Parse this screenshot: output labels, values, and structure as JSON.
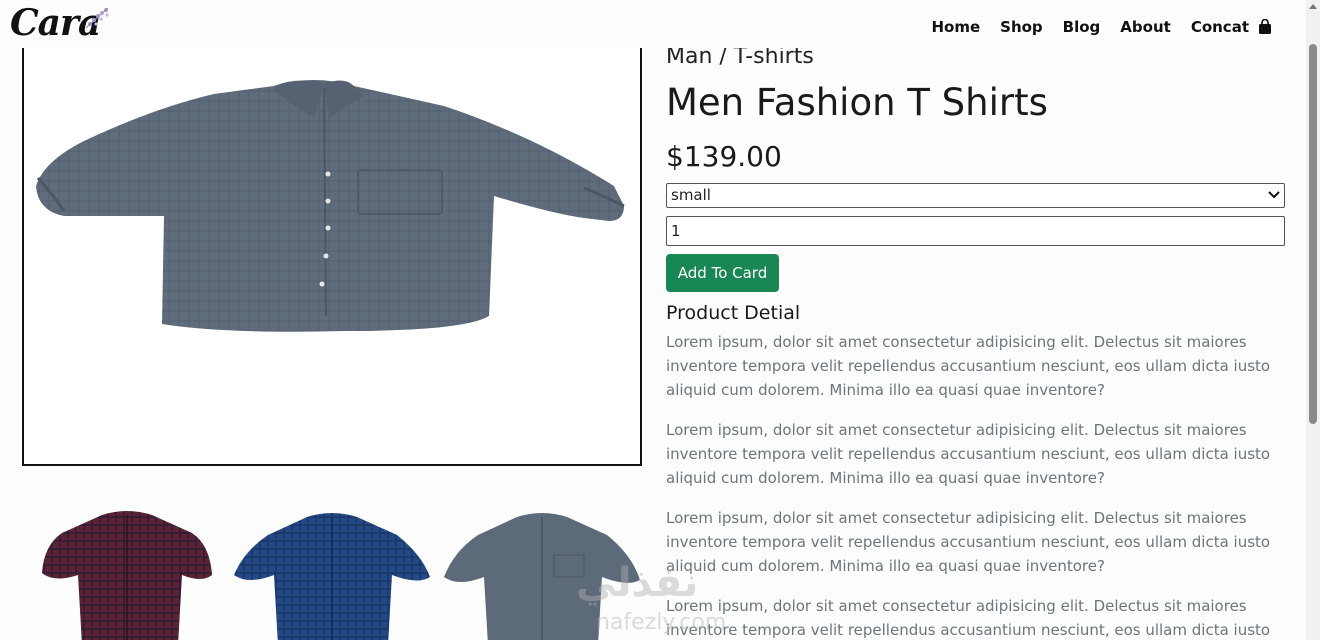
{
  "brand": {
    "logo_text": "Cara"
  },
  "nav": {
    "items": [
      {
        "label": "Home"
      },
      {
        "label": "Shop"
      },
      {
        "label": "Blog"
      },
      {
        "label": "About"
      },
      {
        "label": "Concat"
      }
    ],
    "cart_icon": "shopping-bag-icon"
  },
  "product": {
    "breadcrumb": "Man / T-shirts",
    "title": "Men Fashion T Shirts",
    "price": "$139.00",
    "size_selected": "small",
    "quantity_value": "1",
    "add_button_label": "Add To Card",
    "details_heading": "Product Detial",
    "paragraphs": [
      "Lorem ipsum, dolor sit amet consectetur adipisicing elit. Delectus sit maiores inventore tempora velit repellendus accusantium nesciunt, eos ullam dicta iusto aliquid cum dolorem. Minima illo ea quasi quae inventore?",
      "Lorem ipsum, dolor sit amet consectetur adipisicing elit. Delectus sit maiores inventore tempora velit repellendus accusantium nesciunt, eos ullam dicta iusto aliquid cum dolorem. Minima illo ea quasi quae inventore?",
      "Lorem ipsum, dolor sit amet consectetur adipisicing elit. Delectus sit maiores inventore tempora velit repellendus accusantium nesciunt, eos ullam dicta iusto aliquid cum dolorem. Minima illo ea quasi quae inventore?",
      "Lorem ipsum, dolor sit amet consectetur adipisicing elit. Delectus sit maiores inventore tempora velit repellendus accusantium nesciunt, eos ullam dicta iusto aliquid cum"
    ]
  },
  "thumbnails": [
    {
      "color": "#5a2436",
      "name": "maroon-plaid-shirt"
    },
    {
      "color": "#234a86",
      "name": "blue-plaid-shirt"
    },
    {
      "color": "#5d6a7a",
      "name": "grey-shirt"
    }
  ],
  "main_image_color": "#5f6c7c",
  "accent_color": "#198754",
  "watermark": {
    "arabic": "نفذلي",
    "latin": "nafezly.com"
  }
}
